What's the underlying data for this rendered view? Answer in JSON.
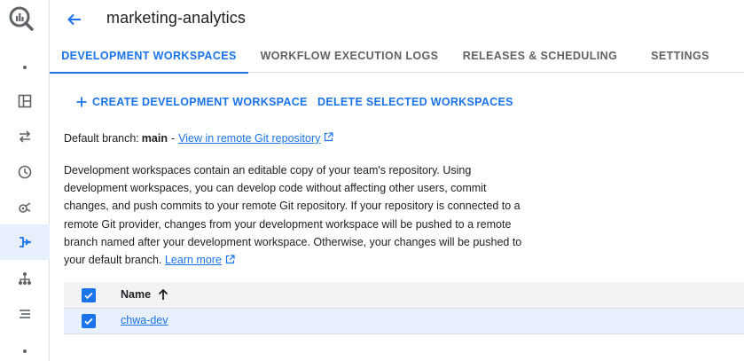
{
  "header": {
    "title": "marketing-analytics",
    "back_icon": "arrow-back-icon"
  },
  "tabs": [
    {
      "label": "DEVELOPMENT WORKSPACES",
      "active": true
    },
    {
      "label": "WORKFLOW EXECUTION LOGS",
      "active": false
    },
    {
      "label": "RELEASES & SCHEDULING",
      "active": false
    },
    {
      "label": "SETTINGS",
      "active": false
    }
  ],
  "actions": {
    "create_label": "CREATE DEVELOPMENT WORKSPACE",
    "delete_label": "DELETE SELECTED WORKSPACES"
  },
  "default_branch": {
    "prefix": "Default branch:",
    "branch": "main",
    "separator": "-",
    "link_text": "View in remote Git repository"
  },
  "description": {
    "text": "Development workspaces contain an editable copy of your team's repository. Using development workspaces, you can develop code without affecting other users, commit changes, and push commits to your remote Git repository. If your repository is connected to a remote Git provider, changes from your development workspace will be pushed to a remote branch named after your development workspace. Otherwise, your changes will be pushed to your default branch.",
    "learn_more": "Learn more"
  },
  "table": {
    "column_name": "Name",
    "sort": "ascending",
    "header_checked": true,
    "rows": [
      {
        "name": "chwa-dev",
        "checked": true
      }
    ]
  },
  "colors": {
    "accent": "#1a73e8",
    "selected_row": "#e8f0fe",
    "header_row": "#f1f3f4"
  }
}
